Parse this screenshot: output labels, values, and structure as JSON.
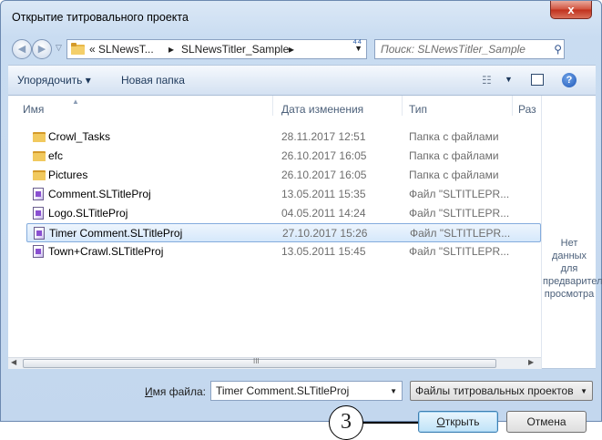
{
  "window": {
    "title": "Открытие титровального проекта",
    "close_label": "x"
  },
  "nav": {
    "breadcrumbs": [
      "« SLNewsT...",
      "SLNewsTitler_Sample"
    ],
    "crumb_separator": "▸",
    "search_placeholder": "Поиск: SLNewsTitler_Sample"
  },
  "toolbar": {
    "organize_label": "Упорядочить ▾",
    "new_folder_label": "Новая папка"
  },
  "columns": {
    "name": "Имя",
    "date": "Дата изменения",
    "type": "Тип",
    "size": "Раз"
  },
  "files": [
    {
      "name": "Crowl_Tasks",
      "date": "28.11.2017 12:51",
      "type": "Папка с файлами",
      "kind": "folder"
    },
    {
      "name": "efc",
      "date": "26.10.2017 16:05",
      "type": "Папка с файлами",
      "kind": "folder"
    },
    {
      "name": "Pictures",
      "date": "26.10.2017 16:05",
      "type": "Папка с файлами",
      "kind": "folder"
    },
    {
      "name": "Comment.SLTitleProj",
      "date": "13.05.2011 15:35",
      "type": "Файл \"SLTITLEPR...",
      "kind": "file"
    },
    {
      "name": "Logo.SLTitleProj",
      "date": "04.05.2011 14:24",
      "type": "Файл \"SLTITLEPR...",
      "kind": "file"
    },
    {
      "name": "Timer Comment.SLTitleProj",
      "date": "27.10.2017 15:26",
      "type": "Файл \"SLTITLEPR...",
      "kind": "file",
      "selected": true
    },
    {
      "name": "Town+Crawl.SLTitleProj",
      "date": "13.05.2011 15:45",
      "type": "Файл \"SLTITLEPR...",
      "kind": "file"
    }
  ],
  "preview": {
    "text": "Нет данных для предварительного просмотра"
  },
  "scrollbar": {
    "grip": "III"
  },
  "bottom": {
    "filename_label": "Имя файла:",
    "filename_value": "Timer Comment.SLTitleProj",
    "filetype_value": "Файлы титровальных проектов",
    "open_label": "Открыть",
    "cancel_label": "Отмена"
  },
  "callout": {
    "number": "3"
  },
  "colors": {
    "selection": "#d5e8fb",
    "folder": "#e8b84a",
    "close": "#c0301c"
  }
}
